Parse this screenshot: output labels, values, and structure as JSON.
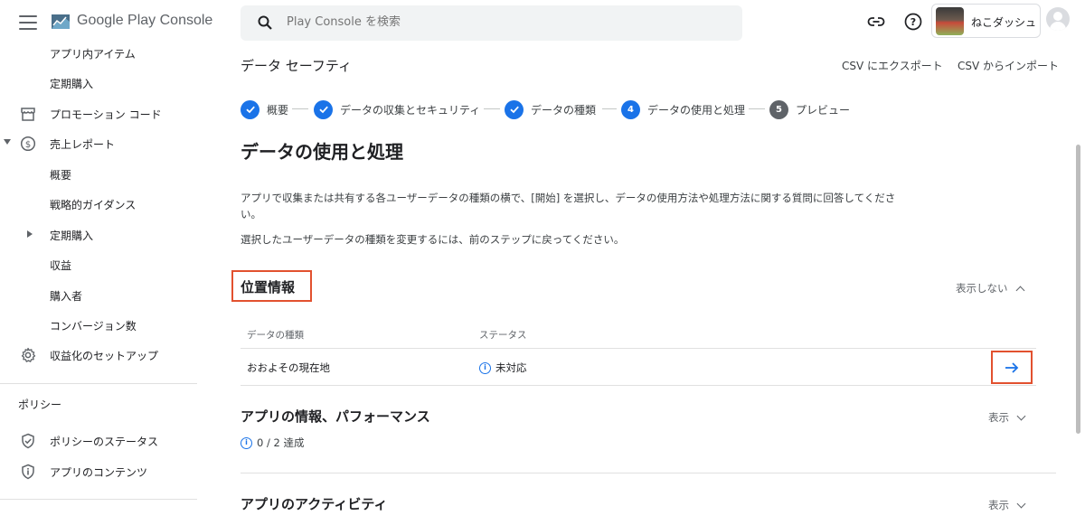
{
  "brand": {
    "name": "Google Play",
    "suffix": "Console"
  },
  "sidebar": {
    "items": [
      {
        "label": "アプリ内アイテム"
      },
      {
        "label": "定期購入"
      },
      {
        "label": "プロモーション コード"
      },
      {
        "label": "売上レポート"
      },
      {
        "label": "概要"
      },
      {
        "label": "戦略的ガイダンス"
      },
      {
        "label": "定期購入"
      },
      {
        "label": "収益"
      },
      {
        "label": "購入者"
      },
      {
        "label": "コンバージョン数"
      },
      {
        "label": "収益化のセットアップ"
      }
    ],
    "policy_section": "ポリシー",
    "policy_items": [
      {
        "label": "ポリシーのステータス"
      },
      {
        "label": "アプリのコンテンツ"
      }
    ]
  },
  "search": {
    "placeholder": "Play Console を検索"
  },
  "account": {
    "name": "ねこダッシュ"
  },
  "header": {
    "title": "データ セーフティ",
    "export_label": "CSV にエクスポート",
    "import_label": "CSV からインポート"
  },
  "stepper": {
    "steps": [
      {
        "label": "概要",
        "state": "done"
      },
      {
        "label": "データの収集とセキュリティ",
        "state": "done"
      },
      {
        "label": "データの種類",
        "state": "done"
      },
      {
        "label": "データの使用と処理",
        "state": "current",
        "number": "4"
      },
      {
        "label": "プレビュー",
        "state": "todo",
        "number": "5"
      }
    ]
  },
  "main": {
    "title": "データの使用と処理",
    "desc1": "アプリで収集または共有する各ユーザーデータの種類の横で、[開始] を選択し、データの使用方法や処理方法に関する質問に回答してくださ",
    "desc1b": "い。",
    "desc2": "選択したユーザーデータの種類を変更するには、前のステップに戻ってください。"
  },
  "sections": [
    {
      "title": "位置情報",
      "toggle": "表示しない",
      "expanded": true,
      "table": {
        "headers": [
          "データの種類",
          "ステータス"
        ],
        "rows": [
          {
            "type": "おおよその現在地",
            "status": "未対応"
          }
        ]
      }
    },
    {
      "title": "アプリの情報、パフォーマンス",
      "toggle": "表示",
      "expanded": false,
      "progress": "0 / 2 達成"
    },
    {
      "title": "アプリのアクティビティ",
      "toggle": "表示",
      "expanded": false
    }
  ],
  "colors": {
    "accent": "#1a73e8",
    "highlight": "#e2512f"
  }
}
